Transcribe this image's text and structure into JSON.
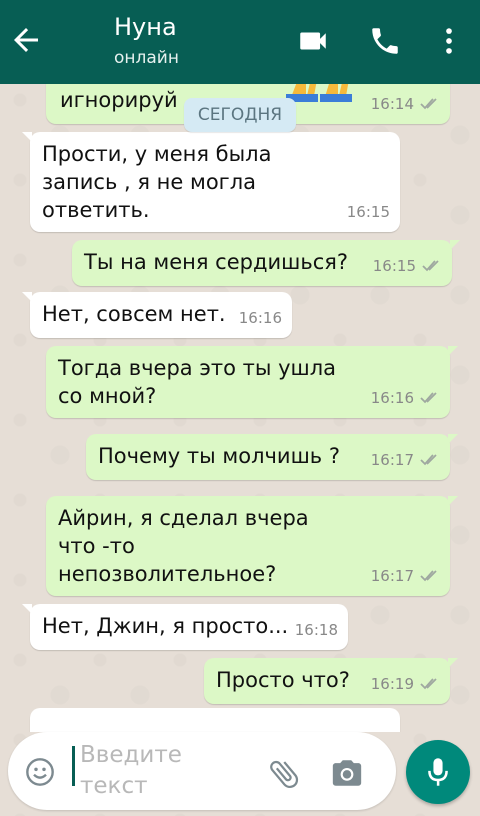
{
  "header": {
    "contact_name": "Нуна",
    "status": "онлайн"
  },
  "date_chip": "СЕГОДНЯ",
  "messages": [
    {
      "dir": "out",
      "text": "игнорируй",
      "time": "16:14",
      "checks": "double"
    },
    {
      "dir": "in",
      "text": "Прости, у меня была\nзапись , я не могла\nответить.",
      "time": "16:15"
    },
    {
      "dir": "out",
      "text": "Ты на меня сердишься?",
      "time": "16:15",
      "checks": "double"
    },
    {
      "dir": "in",
      "text": "Нет, совсем нет.",
      "time": "16:16"
    },
    {
      "dir": "out",
      "text": "Тогда вчера это ты ушла\nсо мной?",
      "time": "16:16",
      "checks": "double"
    },
    {
      "dir": "out",
      "text": "Почему ты молчишь ?",
      "time": "16:17",
      "checks": "double"
    },
    {
      "dir": "out",
      "text": "Айрин, я сделал вчера\nчто -то\nнепозволительное?",
      "time": "16:17",
      "checks": "double"
    },
    {
      "dir": "in",
      "text": "Нет, Джин, я просто...",
      "time": "16:18"
    },
    {
      "dir": "out",
      "text": "Просто что?",
      "time": "16:19",
      "checks": "double"
    }
  ],
  "input": {
    "placeholder": "Введите\nтекст"
  },
  "colors": {
    "header": "#075e54",
    "outgoing_bubble": "#dcf8c6",
    "incoming_bubble": "#ffffff",
    "mic_button": "#00897b",
    "date_chip": "#d5eaf4"
  },
  "icons": [
    "back-arrow-icon",
    "video-call-icon",
    "phone-icon",
    "more-vert-icon",
    "emoji-icon",
    "attach-icon",
    "camera-icon",
    "mic-icon",
    "double-check-icon",
    "praying-hands-emoji"
  ]
}
